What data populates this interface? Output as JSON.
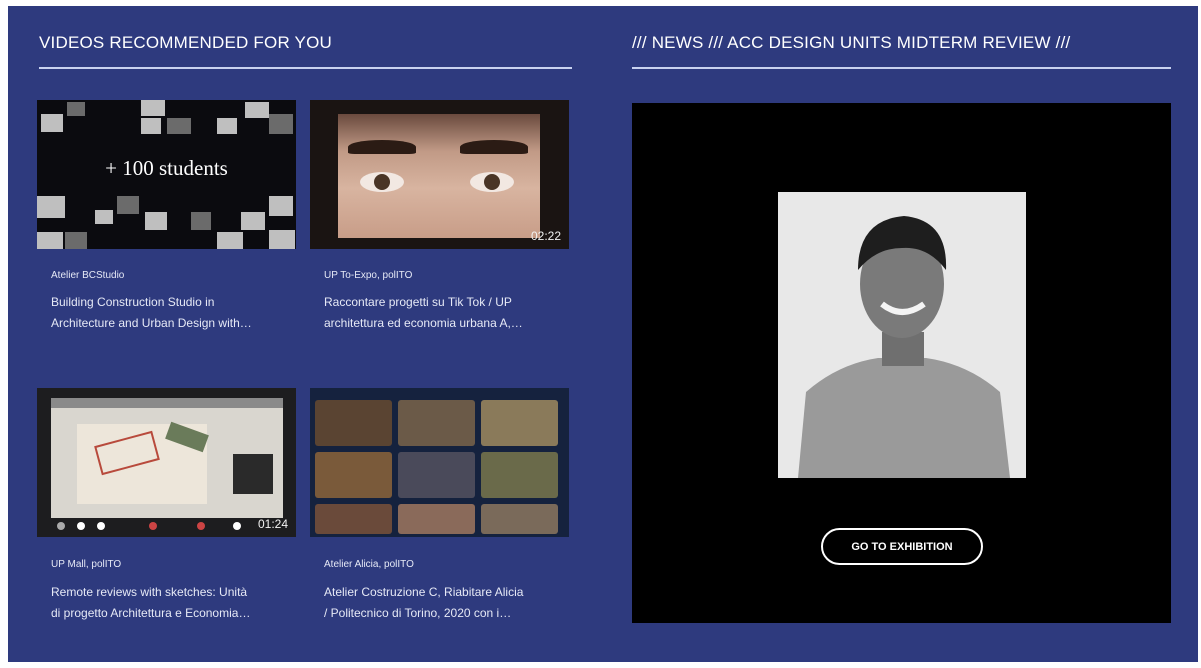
{
  "videos_section": {
    "title": "VIDEOS RECOMMENDED FOR YOU",
    "videos": [
      {
        "channel": "Atelier BCStudio",
        "title_line1": "Building Construction Studio in",
        "title_line2": "Architecture and Urban Design with…",
        "thumb_text": "+ 100 students",
        "duration": ""
      },
      {
        "channel": "UP To-Expo, polITO",
        "title_line1": "Raccontare progetti su Tik Tok / UP",
        "title_line2": "architettura ed economia urbana A,…",
        "duration": "02:22"
      },
      {
        "channel": "UP Mall, polITO",
        "title_line1": "Remote reviews with sketches: Unità",
        "title_line2": "di progetto Architettura e Economia…",
        "duration": "01:24"
      },
      {
        "channel": "Atelier Alicia, polITO",
        "title_line1": "Atelier Costruzione C, Riabitare Alicia",
        "title_line2": "/ Politecnico di Torino, 2020 con i…",
        "duration": ""
      }
    ]
  },
  "news_section": {
    "title": "/// NEWS /// ACC DESIGN UNITS MIDTERM REVIEW ///",
    "button_label": "GO TO EXHIBITION"
  },
  "colors": {
    "background": "#2e3a7e",
    "rule": "#c9d2f0",
    "panel": "#000000"
  }
}
